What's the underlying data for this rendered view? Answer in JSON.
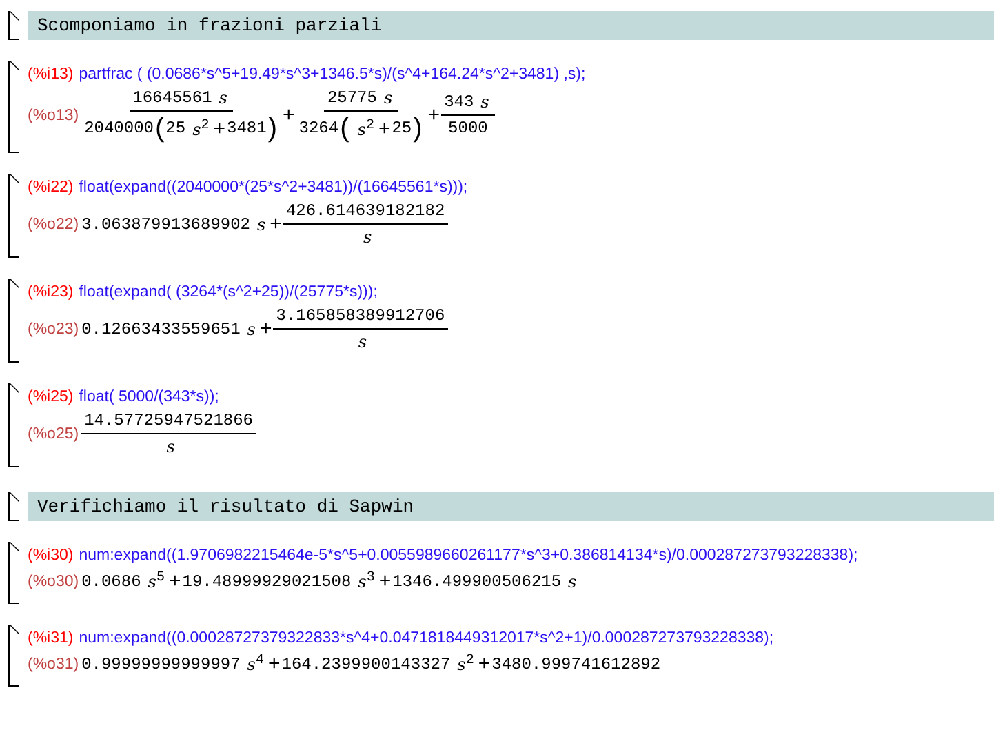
{
  "cells": [
    {
      "kind": "section",
      "title": "Scomponiamo in frazioni parziali"
    },
    {
      "kind": "io",
      "input_label": "(%i13)",
      "input": "partfrac ( (0.0686*s^5+19.49*s^3+1346.5*s)/(s^4+164.24*s^2+3481) ,s);",
      "output_label": "(%o13)",
      "output": [
        {
          "kind": "frac",
          "num": [
            {
              "kind": "num",
              "text": "16645561"
            },
            {
              "kind": "var",
              "text": "s"
            }
          ],
          "den": [
            {
              "kind": "num",
              "text": "2040000"
            },
            {
              "kind": "paren",
              "text": "("
            },
            {
              "kind": "num",
              "text": "25"
            },
            {
              "kind": "var",
              "text": "s",
              "exp": "2"
            },
            {
              "kind": "op",
              "text": "+"
            },
            {
              "kind": "num",
              "text": "3481"
            },
            {
              "kind": "paren",
              "text": ")"
            }
          ]
        },
        {
          "kind": "op",
          "text": "+"
        },
        {
          "kind": "frac",
          "num": [
            {
              "kind": "num",
              "text": "25775"
            },
            {
              "kind": "var",
              "text": "s"
            }
          ],
          "den": [
            {
              "kind": "num",
              "text": "3264"
            },
            {
              "kind": "paren",
              "text": "("
            },
            {
              "kind": "var",
              "text": "s",
              "exp": "2"
            },
            {
              "kind": "op",
              "text": "+"
            },
            {
              "kind": "num",
              "text": "25"
            },
            {
              "kind": "paren",
              "text": ")"
            }
          ]
        },
        {
          "kind": "op",
          "text": "+"
        },
        {
          "kind": "frac",
          "num": [
            {
              "kind": "num",
              "text": "343"
            },
            {
              "kind": "var",
              "text": "s"
            }
          ],
          "den": [
            {
              "kind": "num",
              "text": "5000"
            }
          ]
        }
      ]
    },
    {
      "kind": "io",
      "input_label": "(%i22)",
      "input": "float(expand((2040000*(25*s^2+3481))/(16645561*s)));",
      "output_label": "(%o22)",
      "output": [
        {
          "kind": "num",
          "text": "3.063879913689902"
        },
        {
          "kind": "var",
          "text": "s"
        },
        {
          "kind": "op",
          "text": "+"
        },
        {
          "kind": "frac",
          "num": [
            {
              "kind": "num",
              "text": "426.614639182182"
            }
          ],
          "den": [
            {
              "kind": "var",
              "text": "s"
            }
          ]
        }
      ]
    },
    {
      "kind": "io",
      "input_label": "(%i23)",
      "input": "float(expand( (3264*(s^2+25))/(25775*s)));",
      "output_label": "(%o23)",
      "output": [
        {
          "kind": "num",
          "text": "0.12663433559651"
        },
        {
          "kind": "var",
          "text": "s"
        },
        {
          "kind": "op",
          "text": "+"
        },
        {
          "kind": "frac",
          "num": [
            {
              "kind": "num",
              "text": "3.165858389912706"
            }
          ],
          "den": [
            {
              "kind": "var",
              "text": "s"
            }
          ]
        }
      ]
    },
    {
      "kind": "io",
      "input_label": "(%i25)",
      "input": "float( 5000/(343*s));",
      "output_label": "(%o25)",
      "output": [
        {
          "kind": "frac",
          "num": [
            {
              "kind": "num",
              "text": "14.57725947521866"
            }
          ],
          "den": [
            {
              "kind": "var",
              "text": "s"
            }
          ]
        }
      ]
    },
    {
      "kind": "section",
      "title": "Verifichiamo il risultato di Sapwin"
    },
    {
      "kind": "io",
      "input_label": "(%i30)",
      "input": "num:expand((1.9706982215464e-5*s^5+0.0055989660261177*s^3+0.386814134*s)/0.000287273793228338);",
      "output_label": "(%o30)",
      "output": [
        {
          "kind": "num",
          "text": "0.0686"
        },
        {
          "kind": "var",
          "text": "s",
          "exp": "5"
        },
        {
          "kind": "op",
          "text": "+"
        },
        {
          "kind": "num",
          "text": "19.48999929021508"
        },
        {
          "kind": "var",
          "text": "s",
          "exp": "3"
        },
        {
          "kind": "op",
          "text": "+"
        },
        {
          "kind": "num",
          "text": "1346.499900506215"
        },
        {
          "kind": "var",
          "text": "s"
        }
      ]
    },
    {
      "kind": "io",
      "input_label": "(%i31)",
      "input": "num:expand((0.00028727379322833*s^4+0.0471818449312017*s^2+1)/0.000287273793228338);",
      "output_label": "(%o31)",
      "output": [
        {
          "kind": "num",
          "text": "0.99999999999997"
        },
        {
          "kind": "var",
          "text": "s",
          "exp": "4"
        },
        {
          "kind": "op",
          "text": "+"
        },
        {
          "kind": "num",
          "text": "164.2399900143327"
        },
        {
          "kind": "var",
          "text": "s",
          "exp": "2"
        },
        {
          "kind": "op",
          "text": "+"
        },
        {
          "kind": "num",
          "text": "3480.999741612892"
        }
      ]
    }
  ]
}
